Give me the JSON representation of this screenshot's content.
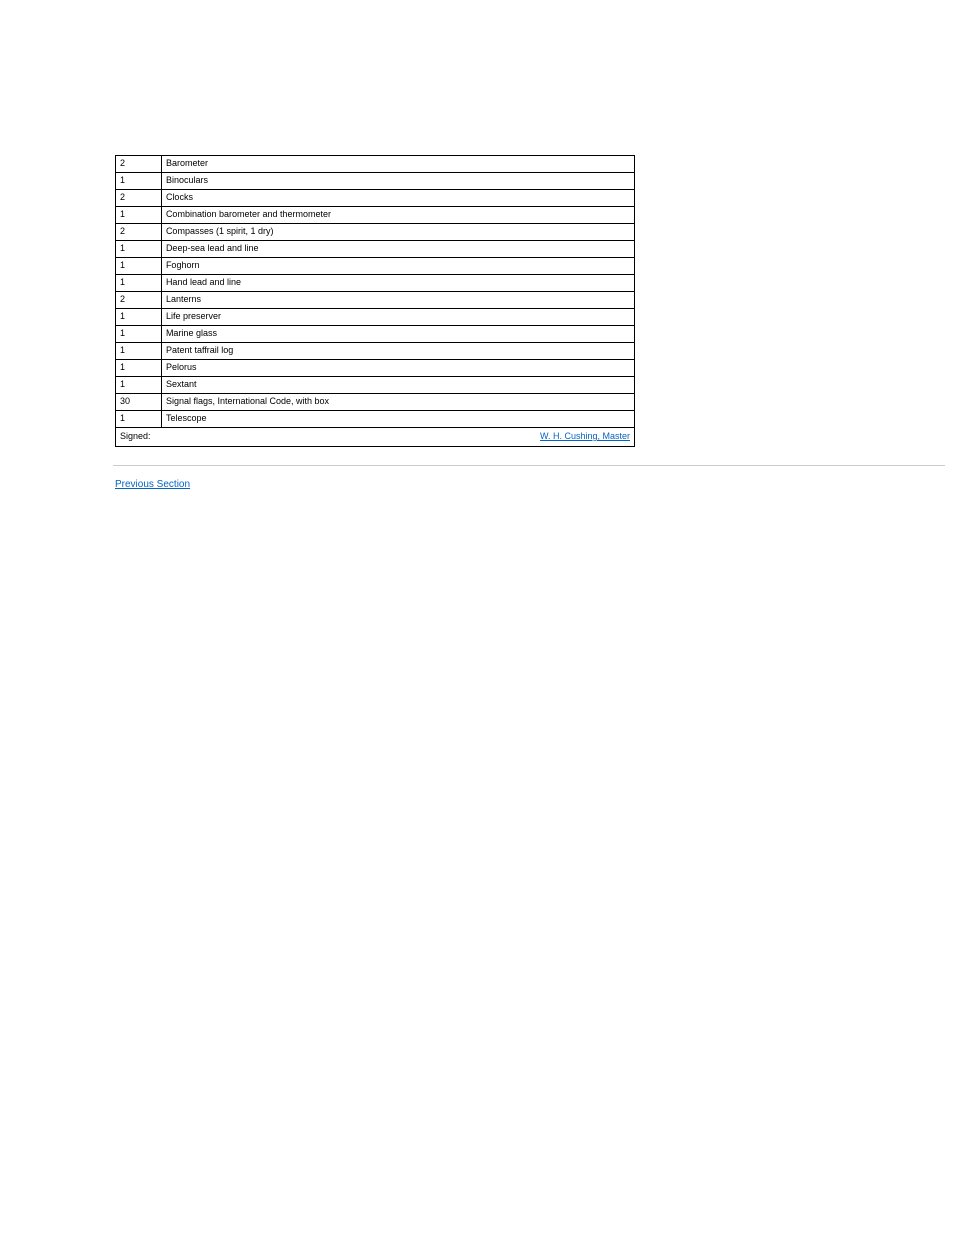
{
  "table": {
    "rows": [
      {
        "num": "2",
        "item": "Barometer"
      },
      {
        "num": "1",
        "item": "Binoculars"
      },
      {
        "num": "2",
        "item": "Clocks"
      },
      {
        "num": "1",
        "item": "Combination barometer and thermometer"
      },
      {
        "num": "2",
        "item": "Compasses (1 spirit, 1 dry)"
      },
      {
        "num": "1",
        "item": "Deep-sea lead and line"
      },
      {
        "num": "1",
        "item": "Foghorn"
      },
      {
        "num": "1",
        "item": "Hand lead and line"
      },
      {
        "num": "2",
        "item": "Lanterns"
      },
      {
        "num": "1",
        "item": "Life preserver"
      },
      {
        "num": "1",
        "item": "Marine glass"
      },
      {
        "num": "1",
        "item": "Patent taffrail log"
      },
      {
        "num": "1",
        "item": "Pelorus"
      },
      {
        "num": "1",
        "item": "Sextant"
      },
      {
        "num": "30",
        "item": "Signal flags, International Code, with box"
      },
      {
        "num": "1",
        "item": "Telescope"
      }
    ],
    "signed_label": "Signed: ",
    "signed_link_text": "W. H. Cushing, Master"
  },
  "footer": {
    "link_text": "Previous Section"
  }
}
